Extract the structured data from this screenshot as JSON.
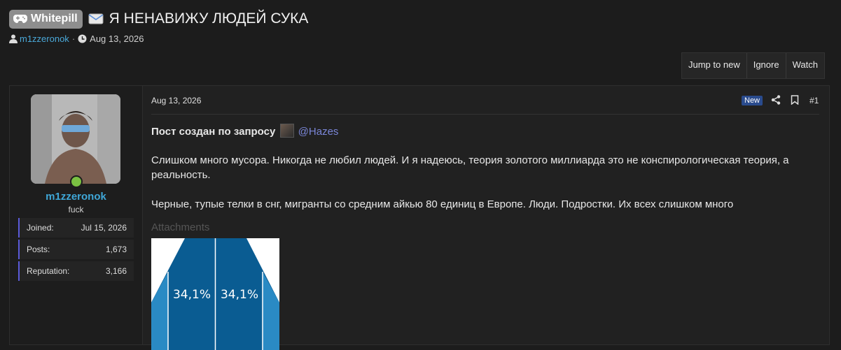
{
  "thread": {
    "prefix_label": "Whitepill",
    "title": "Я НЕНАВИЖУ ЛЮДЕЙ СУКА",
    "author": "m1zzeronok",
    "separator": "·",
    "date": "Aug 13, 2026"
  },
  "actions": {
    "jump_label": "Jump to new",
    "ignore_label": "Ignore",
    "watch_label": "Watch"
  },
  "user": {
    "name": "m1zzeronok",
    "title": "fuck",
    "stats": [
      {
        "label": "Joined:",
        "value": "Jul 15, 2026"
      },
      {
        "label": "Posts:",
        "value": "1,673"
      },
      {
        "label": "Reputation:",
        "value": "3,166"
      }
    ]
  },
  "post": {
    "date": "Aug 13, 2026",
    "badge": "New",
    "number": "#1",
    "request_text": "Пост создан по запросу",
    "mention": "@Hazes",
    "paragraph1": "Слишком много мусора. Никогда не любил людей. И я надеюсь, теория золотого миллиарда это не конспирологическая теория, а реальность.",
    "paragraph2": "Черные, тупые телки в снг, мигранты со средним айкью 80 единиц в Европе. Люди. Подростки. Их всех слишком много",
    "attachments_label": "Attachments",
    "attachment_labels": [
      "34,1%",
      "34,1%"
    ]
  },
  "colors": {
    "link": "#4aa8d8",
    "badge": "#2a4b8d",
    "online": "#7ac142"
  }
}
